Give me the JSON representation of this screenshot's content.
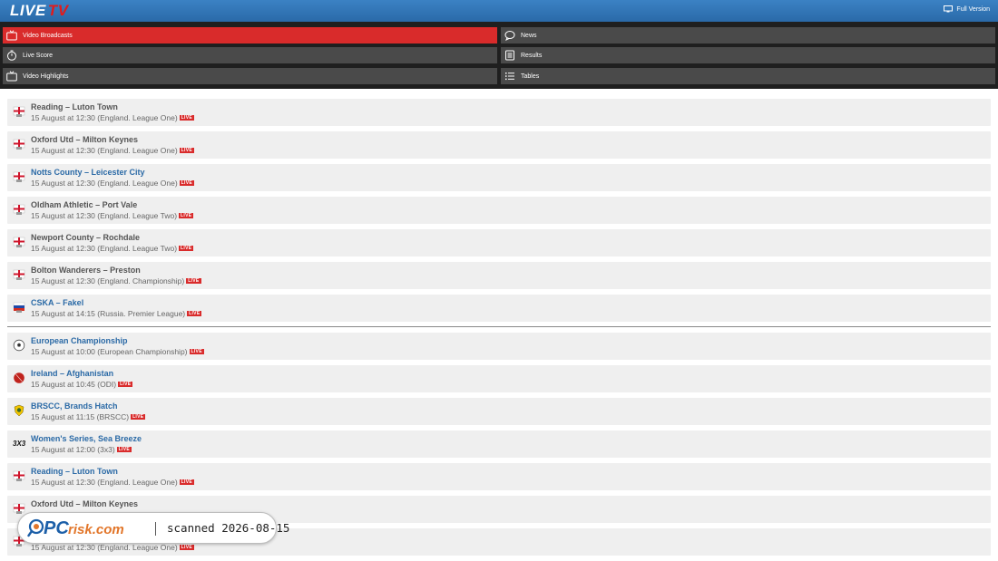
{
  "header": {
    "logo_live": "LIVE",
    "logo_tv": "TV",
    "full_version_label": "Full Version"
  },
  "menu": {
    "video_broadcasts": "Video Broadcasts",
    "news": "News",
    "live_score": "Live Score",
    "results": "Results",
    "video_highlights": "Video Highlights",
    "tables": "Tables"
  },
  "live_badge": "LIVE",
  "events": [
    {
      "title": "Reading – Luton Town",
      "time": "15 August at 12:30",
      "league": "(England. League One)",
      "icon": "england-flag-icon",
      "link": false
    },
    {
      "title": "Oxford Utd – Milton Keynes",
      "time": "15 August at 12:30",
      "league": "(England. League One)",
      "icon": "england-flag-icon",
      "link": false
    },
    {
      "title": "Notts County – Leicester City",
      "time": "15 August at 12:30",
      "league": "(England. League One)",
      "icon": "england-flag-icon",
      "link": true
    },
    {
      "title": "Oldham Athletic – Port Vale",
      "time": "15 August at 12:30",
      "league": "(England. League Two)",
      "icon": "england-flag-icon",
      "link": false
    },
    {
      "title": "Newport County – Rochdale",
      "time": "15 August at 12:30",
      "league": "(England. League Two)",
      "icon": "england-flag-icon",
      "link": false
    },
    {
      "title": "Bolton Wanderers – Preston",
      "time": "15 August at 12:30",
      "league": "(England. Championship)",
      "icon": "england-flag-icon",
      "link": false
    },
    {
      "title": "CSKA – Fakel",
      "time": "15 August at 14:15",
      "league": "(Russia. Premier League)",
      "icon": "russia-flag-icon",
      "link": true
    },
    {
      "title": "European Championship",
      "time": "15 August at 10:00",
      "league": "(European Championship)",
      "icon": "soccer-ball-icon",
      "link": true
    },
    {
      "title": "Ireland – Afghanistan",
      "time": "15 August at 10:45",
      "league": "(ODI)",
      "icon": "cricket-ball-icon",
      "link": true
    },
    {
      "title": "BRSCC, Brands Hatch",
      "time": "15 August at 11:15",
      "league": "(BRSCC)",
      "icon": "brscc-badge-icon",
      "link": true
    },
    {
      "title": "Women's Series, Sea Breeze",
      "time": "15 August at 12:00",
      "league": "(3x3)",
      "icon": "3x3-logo-icon",
      "link": true
    },
    {
      "title": "Reading – Luton Town",
      "time": "15 August at 12:30",
      "league": "(England. League One)",
      "icon": "england-flag-icon",
      "link": true
    },
    {
      "title": "Oxford Utd – Milton Keynes",
      "time": "",
      "league": "",
      "icon": "england-flag-icon",
      "link": false
    },
    {
      "title": "",
      "time": "15 August at 12:30",
      "league": "(England. League One)",
      "icon": "england-flag-icon",
      "link": false
    }
  ],
  "watermark": {
    "brand_pc": "PC",
    "brand_risk": "risk.com",
    "scan_text": "scanned 2026-08-15"
  },
  "colors": {
    "header_blue": "#2a6aa8",
    "active_red": "#d92b2b",
    "link_blue": "#2b6aa6"
  }
}
